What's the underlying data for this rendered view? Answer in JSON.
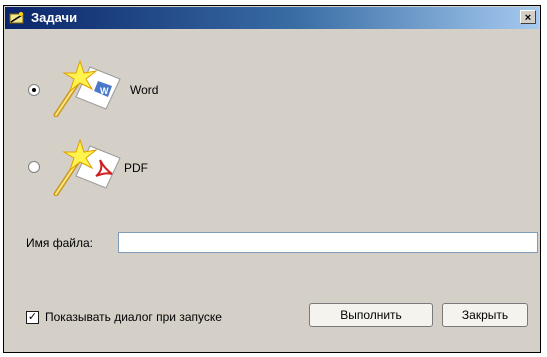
{
  "window": {
    "title": "Задачи",
    "close_glyph": "×"
  },
  "options": [
    {
      "label": "Word",
      "icon": "word-wizard-icon",
      "selected": true
    },
    {
      "label": "PDF",
      "icon": "pdf-wizard-icon",
      "selected": false
    }
  ],
  "file": {
    "label": "Имя файла:",
    "value": "",
    "placeholder": ""
  },
  "show_dialog": {
    "label": "Показывать диалог при запуске",
    "checked": true,
    "check_glyph": "✓"
  },
  "buttons": {
    "run_label": "Выполнить",
    "close_label": "Закрыть"
  },
  "colors": {
    "titlebar_start": "#0a246a",
    "titlebar_end": "#a6caf0",
    "dialog_bg": "#d4d0c8"
  }
}
